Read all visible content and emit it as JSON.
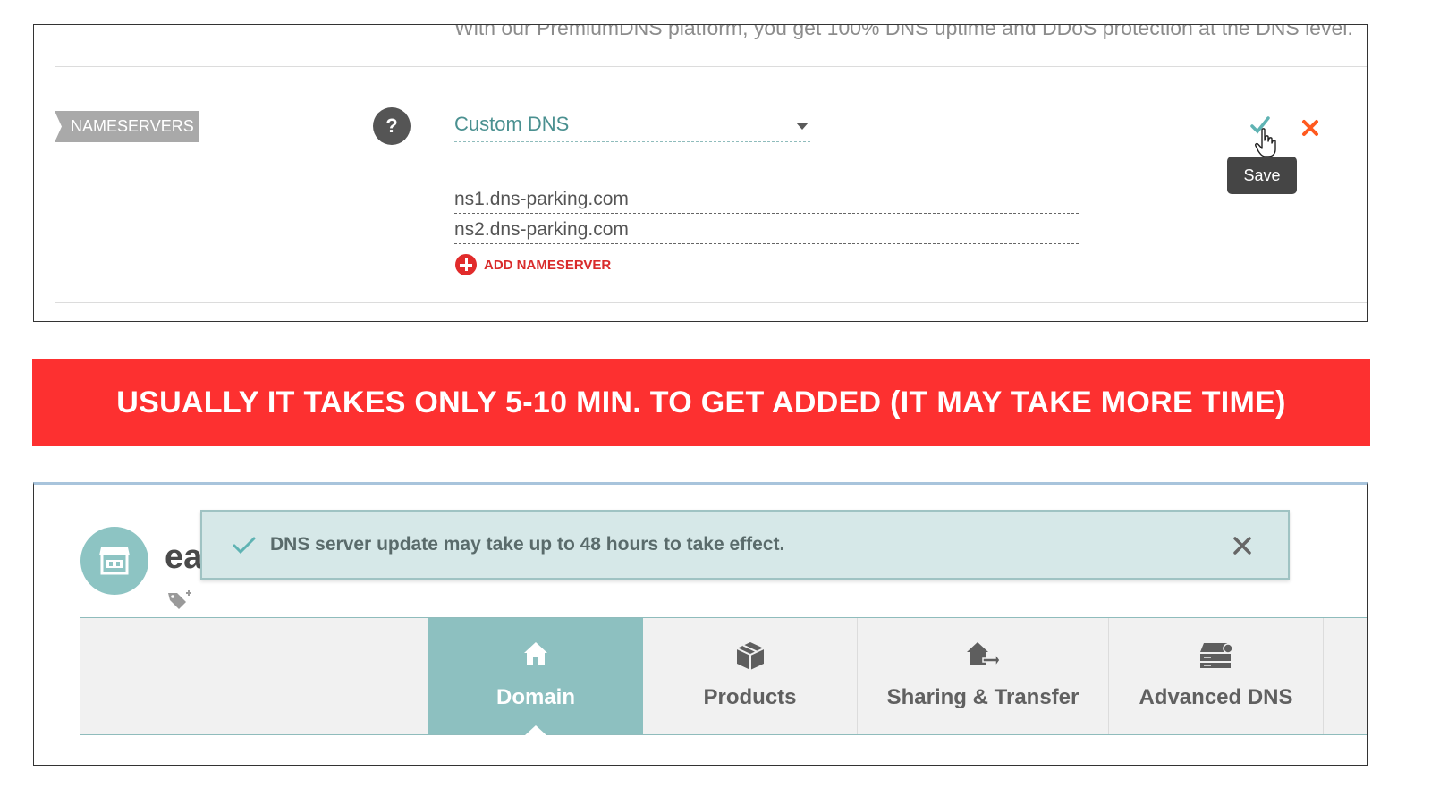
{
  "premium_text": "With our PremiumDNS platform, you get 100% DNS uptime and DDoS protection at the DNS level.",
  "nameservers": {
    "label": "NAMESERVERS",
    "help": "?",
    "selected": "Custom DNS",
    "entries": [
      "ns1.dns-parking.com",
      "ns2.dns-parking.com"
    ],
    "add_label": "ADD NAMESERVER",
    "save_tooltip": "Save"
  },
  "banner": {
    "text": "USUALLY IT TAKES ONLY 5-10 MIN. TO GET ADDED (IT MAY TAKE MORE TIME)",
    "color": "#fd3030"
  },
  "domain_panel": {
    "domain_partial": "ea",
    "notification": "DNS server update may take up to 48 hours to take effect.",
    "tabs": [
      {
        "label": "Domain",
        "icon": "home-icon",
        "active": true
      },
      {
        "label": "Products",
        "icon": "box-icon",
        "active": false
      },
      {
        "label": "Sharing & Transfer",
        "icon": "share-transfer-icon",
        "active": false
      },
      {
        "label": "Advanced DNS",
        "icon": "server-icon",
        "active": false
      }
    ]
  },
  "colors": {
    "accent_teal": "#8dc0c0",
    "check_teal": "#5fb3b3",
    "cancel_orange": "#ff5a1f",
    "add_red": "#e12b2b"
  }
}
